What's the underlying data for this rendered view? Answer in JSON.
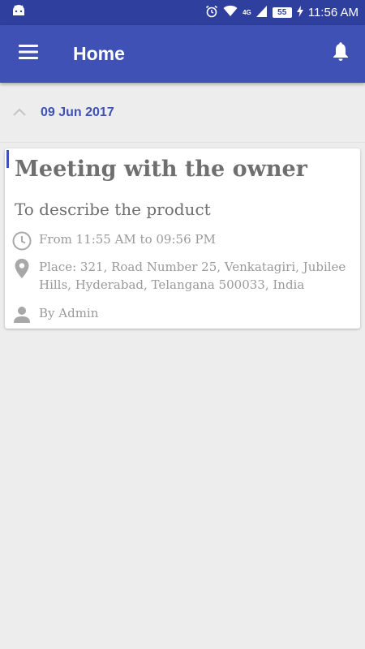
{
  "status_bar": {
    "time": "11:56 AM",
    "battery": "55",
    "network": "4G",
    "icons": [
      "android-icon",
      "alarm-icon",
      "wifi-icon",
      "signal-icon",
      "battery-icon",
      "charging-icon"
    ]
  },
  "app_bar": {
    "title": "Home",
    "menu_icon": "hamburger-menu-icon",
    "notification_icon": "bell-icon"
  },
  "group": {
    "date": "09 Jun 2017",
    "collapse_icon": "chevron-up-icon"
  },
  "event": {
    "title": "Meeting with the owner",
    "description": "To describe the product",
    "time": "From 11:55 AM to 09:56 PM",
    "place": "Place: 321, Road Number 25, Venkatagiri, Jubilee Hills, Hyderabad, Telangana 500033, India",
    "author": "By Admin"
  },
  "colors": {
    "app_bar": "#3f51b5",
    "status_bar": "#2f3f9e",
    "accent": "#3f51b5",
    "background": "#ededed"
  }
}
